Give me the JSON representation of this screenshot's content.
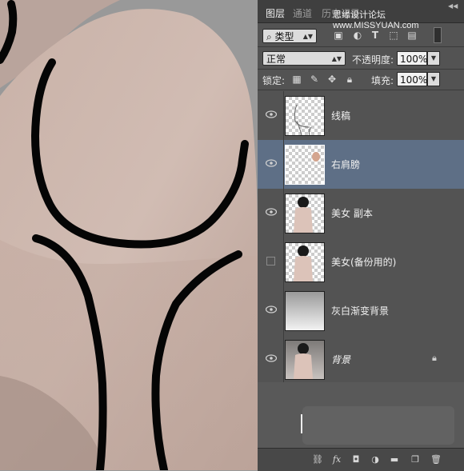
{
  "panel": {
    "tabs": [
      {
        "label": "图层",
        "active": true
      },
      {
        "label": "通道",
        "active": false
      },
      {
        "label": "历史记录",
        "active": false
      }
    ],
    "watermark": "思缘设计论坛  www.MISSYUAN.com",
    "filter_kind": "类型",
    "blend_mode": "正常",
    "opacity_label": "不透明度:",
    "opacity_value": "100%",
    "lock_label": "锁定:",
    "fill_label": "填充:",
    "fill_value": "100%"
  },
  "layers": [
    {
      "name": "线稿",
      "visible": true,
      "selected": false,
      "thumb": "transparent-sketch",
      "locked": false
    },
    {
      "name": "右肩膀",
      "visible": true,
      "selected": true,
      "thumb": "transparent-dot",
      "locked": false
    },
    {
      "name": "美女 副本",
      "visible": true,
      "selected": false,
      "thumb": "photo-transparent",
      "locked": false
    },
    {
      "name": "美女(备份用的)",
      "visible": false,
      "selected": false,
      "thumb": "photo-transparent",
      "locked": false
    },
    {
      "name": "灰白渐变背景",
      "visible": true,
      "selected": false,
      "thumb": "gradient",
      "locked": false
    },
    {
      "name": "背景",
      "visible": true,
      "selected": false,
      "thumb": "photo",
      "locked": true,
      "italic": true
    }
  ],
  "colors": {
    "panel_bg": "#535353",
    "selected_layer": "#5e6f86",
    "canvas_bg": "#9a9a9a",
    "skin": "#cbb6ad",
    "stroke": "#050505"
  },
  "icons": {
    "filter": "search-icon",
    "menu": "panel-menu-icon",
    "eye": "eye-icon",
    "lock": "lock-icon",
    "footer": [
      "link-icon",
      "fx-icon",
      "mask-icon",
      "adjustment-icon",
      "folder-icon",
      "new-layer-icon",
      "trash-icon"
    ]
  }
}
